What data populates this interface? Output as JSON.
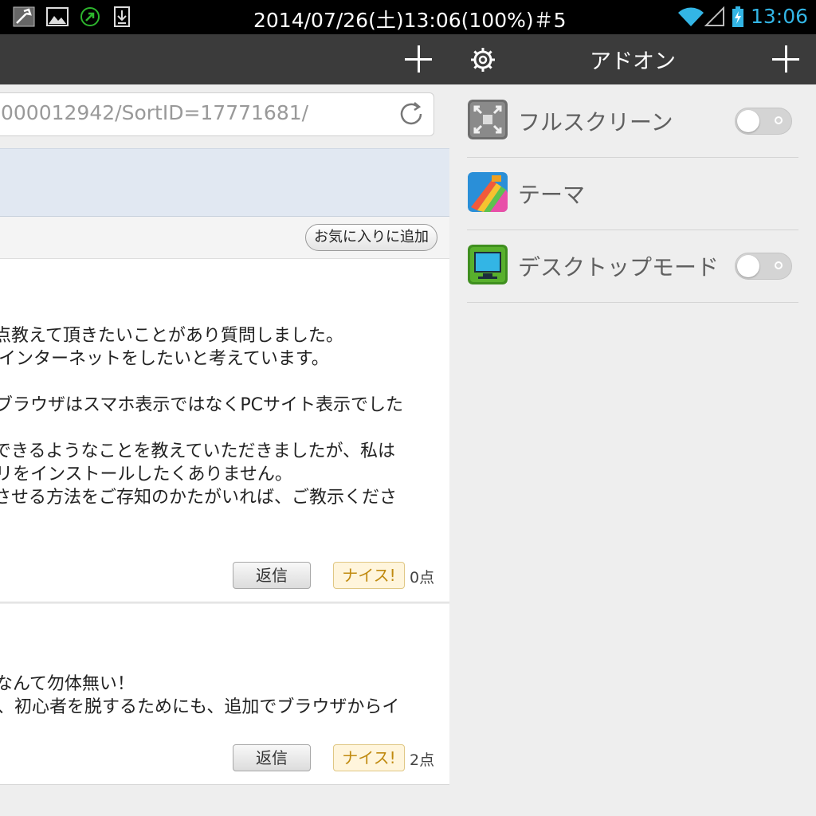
{
  "status_bar": {
    "title": "2014/07/26(土)13:06(100%)＃5",
    "time": "13:06",
    "left_icons": [
      "toolbox-icon",
      "image-icon",
      "sync-icon",
      "download-icon"
    ],
    "right_icons": [
      "wifi-icon",
      "signal-icon",
      "battery-charging-icon"
    ]
  },
  "browser": {
    "url": "000012942/SortID=17771681/",
    "favorite_button": "お気に入りに追加",
    "posts": [
      {
        "lines": [
          "点教えて頂きたいことがあり質問しました。",
          "インターネットをしたいと考えています。",
          "",
          "ブラウザはスマホ表示ではなくPCサイト表示でした",
          "",
          "できるようなことを教えていただきましたが、私は",
          "リをインストールしたくありません。",
          "させる方法をご存知のかたがいれば、ご教示くださ"
        ],
        "reply_label": "返信",
        "nice_label": "ナイス!",
        "points": "0点"
      },
      {
        "lines": [
          "なんて勿体無い！",
          "、初心者を脱するためにも、追加でブラウザからイ"
        ],
        "reply_label": "返信",
        "nice_label": "ナイス!",
        "points": "2点"
      }
    ]
  },
  "addon_panel": {
    "title": "アドオン",
    "items": [
      {
        "label": "フルスクリーン",
        "icon": "fullscreen-icon",
        "has_toggle": true,
        "enabled": false
      },
      {
        "label": "テーマ",
        "icon": "theme-icon",
        "has_toggle": false
      },
      {
        "label": "デスクトップモード",
        "icon": "desktop-mode-icon",
        "has_toggle": true,
        "enabled": false
      }
    ]
  },
  "colors": {
    "status_bar_bg": "#000000",
    "toolbar_bg": "#3b3b3b",
    "panel_bg": "#eeeeee",
    "accent_time": "#33b5e5",
    "nice_text": "#c08a10"
  }
}
